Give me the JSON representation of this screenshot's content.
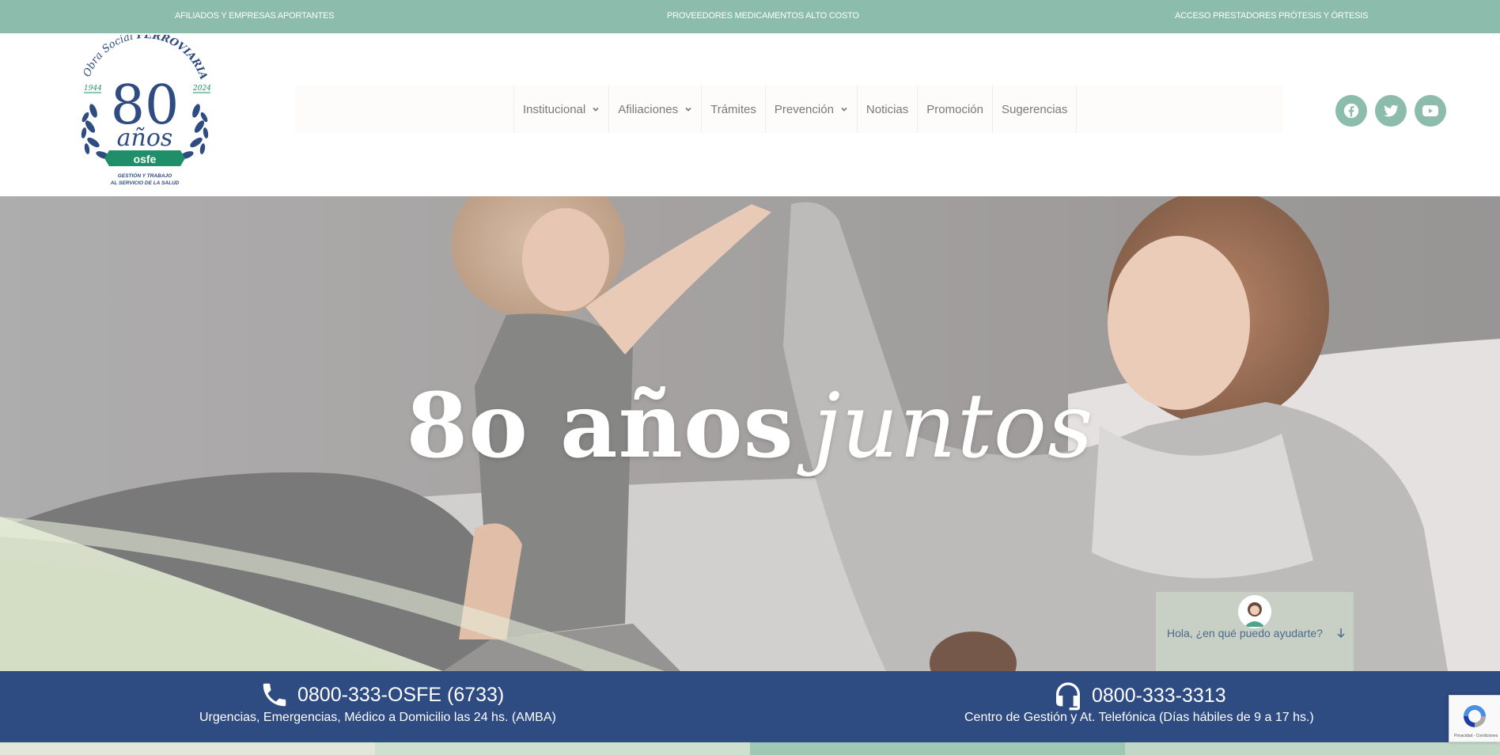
{
  "topbar": {
    "links": [
      "AFILIADOS Y EMPRESAS APORTANTES",
      "PROVEEDORES MEDICAMENTOS ALTO COSTO",
      "ACCESO PRESTADORES PRÓTESIS Y ÓRTESIS"
    ]
  },
  "logo": {
    "arc_text_1": "Obra Social",
    "arc_text_2": "FERROVIARIA",
    "number": "80",
    "word": "años",
    "year_start": "1944",
    "year_end": "2024",
    "brand": "osfe",
    "tagline_1": "GESTIÓN Y TRABAJO",
    "tagline_2": "AL SERVICIO DE LA SALUD"
  },
  "nav": {
    "items": [
      {
        "label": "Institucional",
        "has_submenu": true
      },
      {
        "label": "Afiliaciones",
        "has_submenu": true
      },
      {
        "label": "Trámites",
        "has_submenu": false
      },
      {
        "label": "Prevención",
        "has_submenu": true
      },
      {
        "label": "Noticias",
        "has_submenu": false
      },
      {
        "label": "Promoción",
        "has_submenu": false
      },
      {
        "label": "Sugerencias",
        "has_submenu": false
      }
    ]
  },
  "social": [
    "facebook-icon",
    "twitter-icon",
    "youtube-icon"
  ],
  "hero": {
    "title_main": "8o años",
    "title_italic": "juntos"
  },
  "chat": {
    "text": "Hola, ¿en qué puedo ayudarte?"
  },
  "contact": {
    "left": {
      "phone": "0800-333-OSFE (6733)",
      "description": "Urgencias, Emergencias, Médico a Domicilio las 24 hs. (AMBA)",
      "icon": "phone-icon"
    },
    "right": {
      "phone": "0800-333-3313",
      "description": "Centro de Gestión y At. Telefónica (Días hábiles de 9 a 17 hs.)",
      "icon": "headset-icon"
    }
  },
  "recaptcha": {
    "text": "Privacidad - Condiciones"
  },
  "colors": {
    "accent_green": "#8cbcab",
    "navy": "#2e4b82",
    "logo_blue": "#2e4b82",
    "logo_green": "#1f8f6a"
  }
}
